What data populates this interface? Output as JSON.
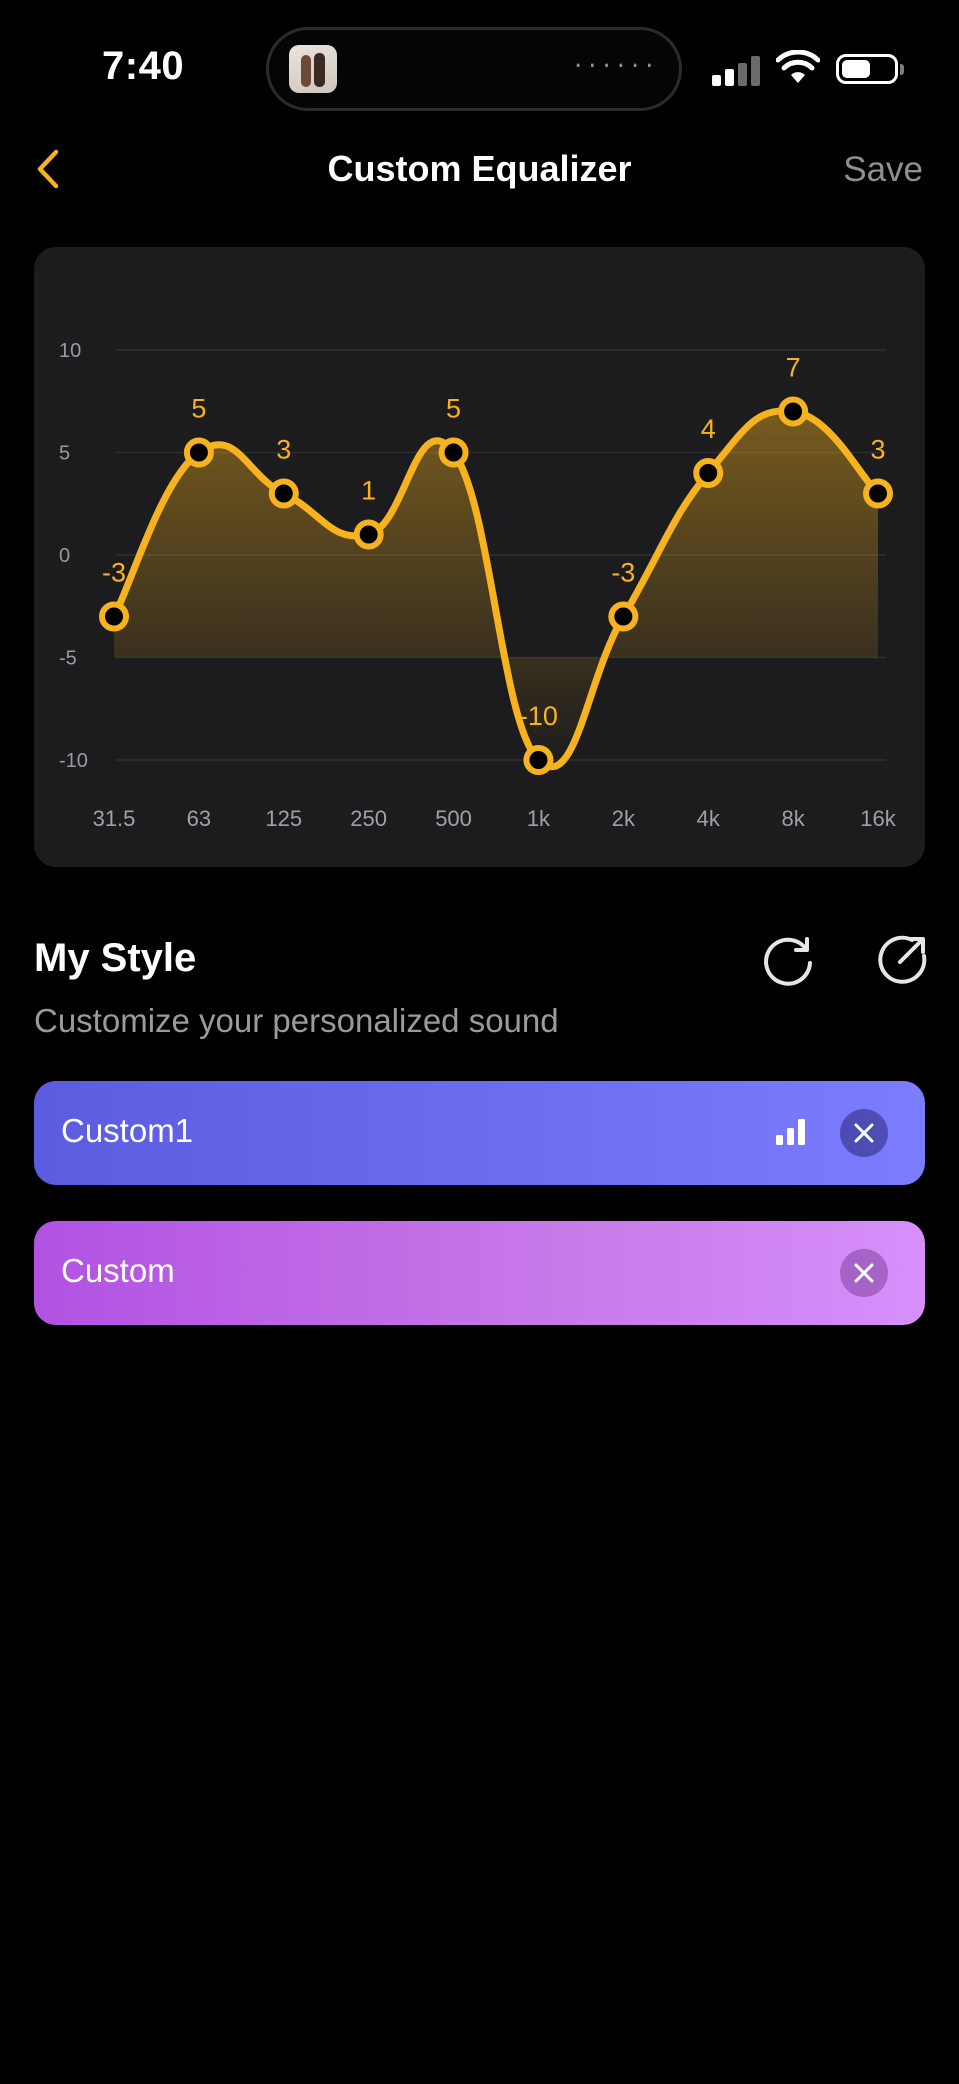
{
  "status_bar": {
    "time": "7:40"
  },
  "nav": {
    "title": "Custom Equalizer",
    "save_label": "Save"
  },
  "colors": {
    "accent": "#F6B21F",
    "card_bg": "#1C1C1E",
    "preset_1_gradient": [
      "#5B5CE0",
      "#7C7CFF"
    ],
    "preset_2_gradient": [
      "#B252E3",
      "#D68FFB"
    ]
  },
  "chart_data": {
    "type": "line",
    "title": "",
    "xlabel": "",
    "ylabel": "",
    "categories": [
      "31.5",
      "63",
      "125",
      "250",
      "500",
      "1k",
      "2k",
      "4k",
      "8k",
      "16k"
    ],
    "series": [
      {
        "values": [
          -3,
          5,
          3,
          1,
          5,
          -10,
          -3,
          4,
          7,
          3
        ]
      }
    ],
    "yticks": [
      10,
      5,
      0,
      -5,
      -10
    ],
    "ylim": [
      -10,
      10
    ],
    "grid": true,
    "smooth": true,
    "area_fill": true,
    "data_labels": true
  },
  "my_style": {
    "title": "My Style",
    "subtitle": "Customize your personalized sound",
    "icons": [
      "reset-icon",
      "share-icon"
    ]
  },
  "presets": [
    {
      "label": "Custom1",
      "active": true
    },
    {
      "label": "Custom",
      "active": false
    }
  ]
}
